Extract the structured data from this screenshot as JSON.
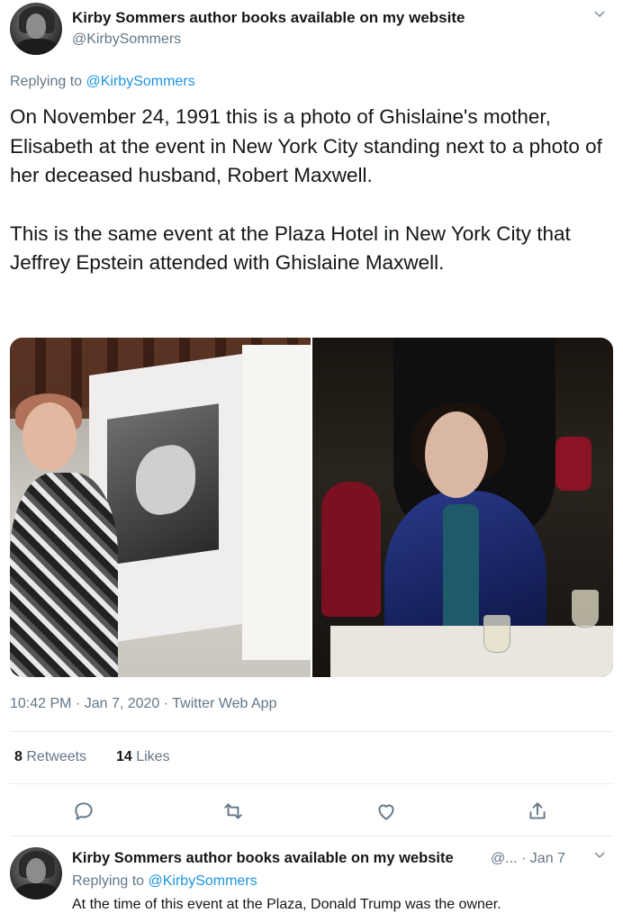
{
  "tweet": {
    "display_name": "Kirby Sommers author books available on my website",
    "handle": "@KirbySommers",
    "replying_prefix": "Replying to",
    "replying_to": "@KirbySommers",
    "paragraphs": [
      "On November 24, 1991 this is a photo of Ghislaine's mother, Elisabeth at the event in New York City standing next to a photo of her deceased husband, Robert Maxwell.",
      "This is the same event at the Plaza Hotel in New York City that Jeffrey Epstein attended with Ghislaine Maxwell."
    ],
    "timestamp": "10:42 PM · Jan 7, 2020 · Twitter Web App",
    "retweets_count": "8",
    "retweets_label": "Retweets",
    "likes_count": "14",
    "likes_label": "Likes"
  },
  "actions": {
    "icons": [
      "reply-icon",
      "retweet-icon",
      "like-icon",
      "share-icon"
    ]
  },
  "reply": {
    "display_name": "Kirby Sommers author books available on my website",
    "handle_and_date": "@... · Jan 7",
    "replying_prefix": "Replying to",
    "replying_to": "@KirbySommers",
    "text": "At the time of this event at the Plaza, Donald Trump was the owner."
  },
  "colors": {
    "text": "#14171a",
    "muted": "#657786",
    "link": "#1b95e0",
    "divider": "#e6ecf0"
  }
}
